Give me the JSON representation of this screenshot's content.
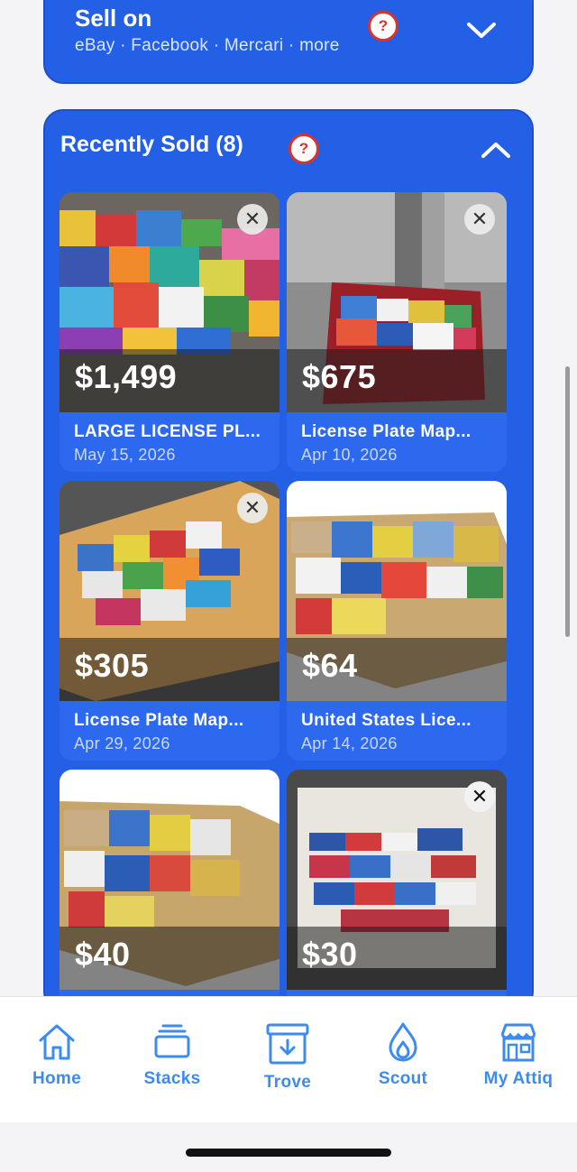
{
  "sell_on": {
    "title": "Sell on",
    "subtitle": "eBay · Facebook · Mercari · more",
    "help_symbol": "?",
    "chevron_icon": "chevron-down-icon"
  },
  "recently_sold": {
    "title": "Recently Sold (8)",
    "help_symbol": "?",
    "chevron_icon": "chevron-up-icon",
    "close_symbol": "✕",
    "items": [
      {
        "price": "$1,499",
        "name": "LARGE LICENSE PL...",
        "date": "May 15, 2026",
        "dismissible": true
      },
      {
        "price": "$675",
        "name": "License Plate Map...",
        "date": "Apr 10, 2026",
        "dismissible": true
      },
      {
        "price": "$305",
        "name": "License Plate Map...",
        "date": "Apr 29, 2026",
        "dismissible": true
      },
      {
        "price": "$64",
        "name": "United States Lice...",
        "date": "Apr 14, 2026",
        "dismissible": false
      },
      {
        "price": "$40",
        "name": "",
        "date": "",
        "dismissible": false
      },
      {
        "price": "$30",
        "name": "",
        "date": "",
        "dismissible": true
      }
    ]
  },
  "tabbar": {
    "tabs": [
      {
        "label": "Home",
        "icon": "home-icon"
      },
      {
        "label": "Stacks",
        "icon": "stacks-icon"
      },
      {
        "label": "Trove",
        "icon": "trove-box-icon"
      },
      {
        "label": "Scout",
        "icon": "flame-icon"
      },
      {
        "label": "My Attiq",
        "icon": "storefront-icon"
      }
    ]
  },
  "colors": {
    "card_blue": "#2460e6",
    "tile_blue": "#2d69ee",
    "tab_blue": "#3c8bf0",
    "help_red": "#d9332b"
  }
}
